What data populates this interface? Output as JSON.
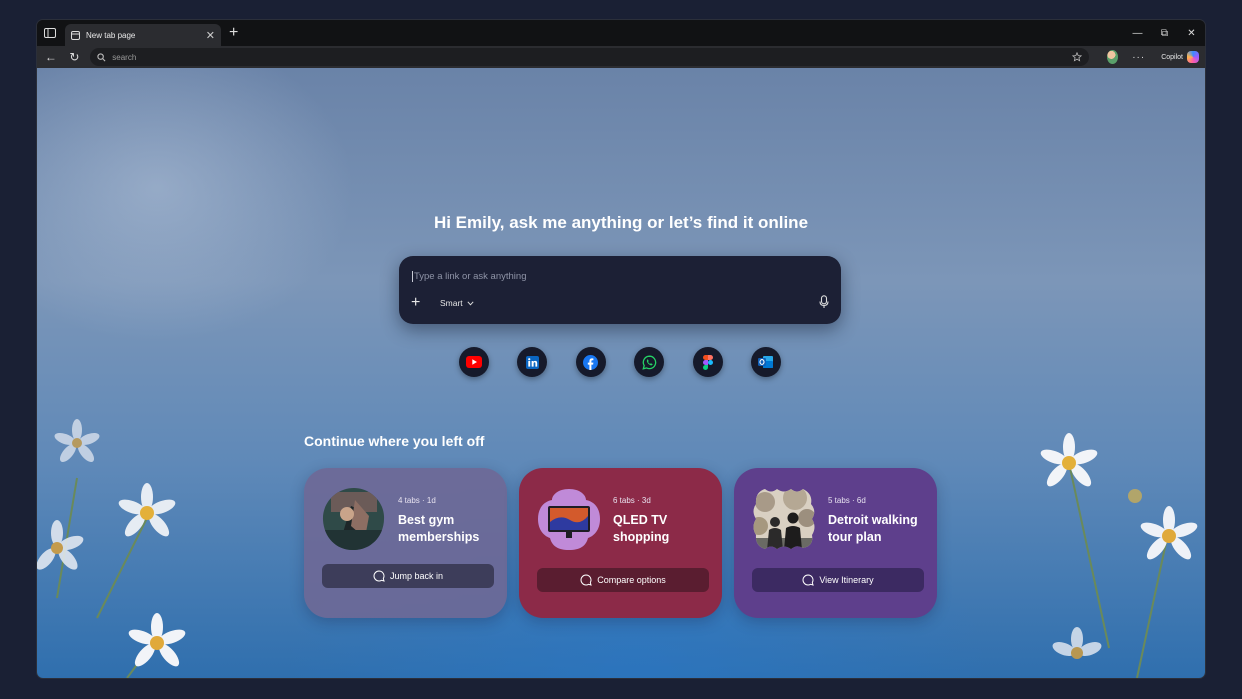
{
  "tab": {
    "title": "New tab page",
    "close": "✕",
    "new": "+"
  },
  "window_controls": {
    "minimize": "—",
    "restore": "⧉",
    "close": "✕"
  },
  "toolbar": {
    "back": "←",
    "reload": "↻",
    "address_placeholder": "search",
    "more": "···",
    "copilot_label": "Copilot"
  },
  "greeting": "Hi Emily, ask me anything or let’s find it online",
  "search": {
    "placeholder": "Type a link or ask anything",
    "plus": "+",
    "mode": "Smart"
  },
  "shortcuts": [
    {
      "name": "youtube",
      "color": "#ff0000"
    },
    {
      "name": "linkedin",
      "color": "#0a66c2"
    },
    {
      "name": "facebook",
      "color": "#1877f2"
    },
    {
      "name": "whatsapp",
      "color": "#25d366"
    },
    {
      "name": "figma",
      "color": "#a259ff"
    },
    {
      "name": "outlook",
      "color": "#0078d4"
    }
  ],
  "continue_title": "Continue where you left off",
  "cards": [
    {
      "meta": "4 tabs · 1d",
      "title": "Best gym memberships",
      "button": "Jump back in",
      "color": "#6e6896"
    },
    {
      "meta": "6 tabs · 3d",
      "title": "QLED TV shopping",
      "button": "Compare options",
      "color": "#8c2a48"
    },
    {
      "meta": "5 tabs · 6d",
      "title": "Detroit walking tour plan",
      "button": "View Itinerary",
      "color": "#5e3f8c"
    }
  ]
}
